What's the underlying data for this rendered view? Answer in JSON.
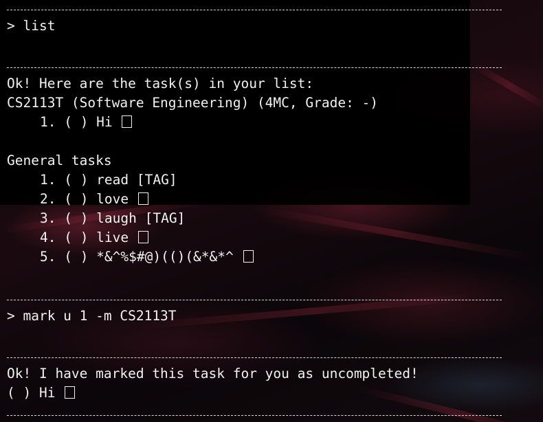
{
  "separator": "------------------------------------------------------------",
  "session": {
    "cmd1": "> list",
    "resp1_header": "Ok! Here are the task(s) in your list:",
    "module_heading": "CS2113T (Software Engineering) (4MC, Grade: -)",
    "module_tasks": [
      {
        "text": "1. ( ) Hi",
        "tag": "[]"
      }
    ],
    "general_heading": "General tasks",
    "general_tasks": [
      {
        "text": "1. ( ) read",
        "tag": "[TAG]"
      },
      {
        "text": "2. ( ) love",
        "tag": "[]"
      },
      {
        "text": "3. ( ) laugh",
        "tag": "[TAG]"
      },
      {
        "text": "4. ( ) live",
        "tag": "[]"
      },
      {
        "text": "5. ( ) *&^%$#@)(()(&*&*^",
        "tag": "[]"
      }
    ],
    "cmd2": "> mark u 1 -m CS2113T",
    "resp2_header": "Ok! I have marked this task for you as uncompleted!",
    "resp2_task": {
      "text": "( ) Hi",
      "tag": "[]"
    }
  },
  "colors": {
    "text": "#f2f2f2",
    "background": "#050305",
    "accent_streak": "#96283c"
  }
}
